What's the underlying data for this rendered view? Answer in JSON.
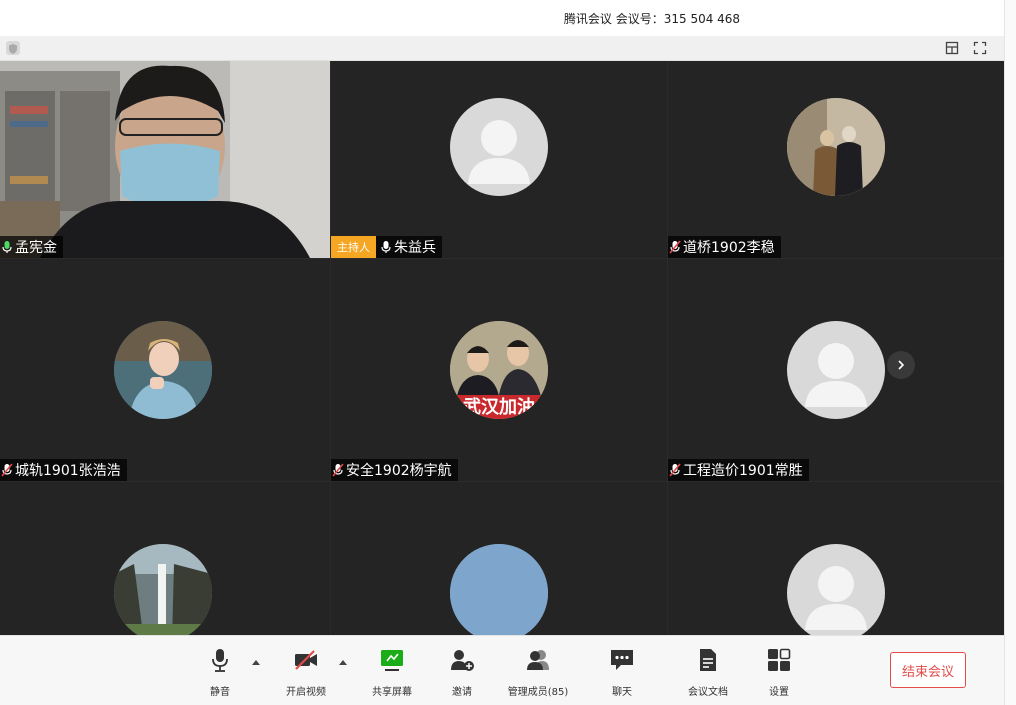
{
  "window": {
    "title": "腾讯会议 会议号：315 504 468"
  },
  "colors": {
    "host_badge": "#f5a623",
    "end_button": "#e34b4b",
    "grid_bg": "#242424",
    "share_green": "#1aad19"
  },
  "participants": [
    {
      "name": "孟宪金",
      "mic": "mic-on-icon",
      "avatar": "camera-video"
    },
    {
      "name": "朱益兵",
      "mic": "mic-on-icon",
      "host_badge": "主持人",
      "avatar": "default-avatar-icon"
    },
    {
      "name": "道桥1902李稳",
      "mic": "mic-muted-icon",
      "avatar": "photo-avatar"
    },
    {
      "name": "城轨1901张浩浩",
      "mic": "mic-muted-icon",
      "avatar": "photo-avatar"
    },
    {
      "name": "安全1902杨宇航",
      "mic": "mic-muted-icon",
      "avatar": "photo-avatar",
      "avatar_caption": "武汉加油"
    },
    {
      "name": "工程造价1901常胜",
      "mic": "mic-muted-icon",
      "avatar": "default-avatar-icon"
    },
    {
      "name": "",
      "avatar": "photo-avatar"
    },
    {
      "name": "",
      "avatar": "photo-avatar"
    },
    {
      "name": "",
      "avatar": "default-avatar-icon"
    }
  ],
  "toolbar": {
    "mute_label": "静音",
    "video_label": "开启视频",
    "share_label": "共享屏幕",
    "invite_label": "邀请",
    "members_label": "管理成员(85)",
    "chat_label": "聊天",
    "docs_label": "会议文档",
    "settings_label": "设置",
    "end_label": "结束会议"
  }
}
